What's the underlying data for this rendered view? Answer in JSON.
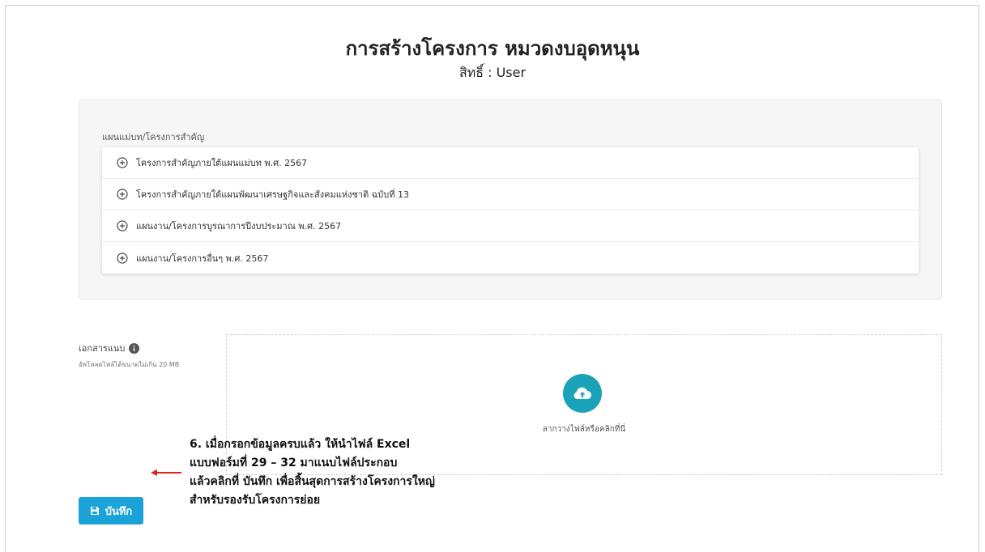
{
  "header": {
    "title": "การสร้างโครงการ หมวดงบอุดหนุน",
    "subtitle": "สิทธิ์ : User"
  },
  "plans": {
    "label": "แผนแม่บท/โครงการสำคัญ",
    "items": [
      {
        "label": "โครงการสำคัญภายใต้แผนแม่บท พ.ศ. 2567",
        "icon": "plus-circle-icon"
      },
      {
        "label": "โครงการสำคัญภายใต้แผนพัฒนาเศรษฐกิจและสังคมแห่งชาติ ฉบับที่ 13",
        "icon": "plus-circle-icon"
      },
      {
        "label": "แผนงาน/โครงการบูรณาการปีงบประมาณ พ.ศ. 2567",
        "icon": "plus-circle-icon"
      },
      {
        "label": "แผนงาน/โครงการอื่นๆ พ.ศ. 2567",
        "icon": "plus-circle-icon"
      }
    ]
  },
  "attachments": {
    "label": "เอกสารแนบ",
    "hint": "อัพโหลดไฟล์ได้ขนาดไม่เกิน 20 MB",
    "dropzone_text": "ลากวางไฟล์หรือคลิกที่นี่",
    "icon": "cloud-upload-icon"
  },
  "annotation": {
    "lines": [
      "6. เมื่อกรอกข้อมูลครบแล้ว ให้นำไฟล์ Excel",
      "แบบฟอร์มที่ 29 – 32 มาแนบไฟล์ประกอบ",
      "แล้วคลิกที่ บันทึก เพื่อสิ้นสุดการสร้างโครงการใหญ่",
      "สำหรับรองรับโครงการย่อย"
    ],
    "arrow_color": "#d9261c"
  },
  "actions": {
    "save_label": "บันทึก",
    "save_color": "#1aa3d8"
  }
}
